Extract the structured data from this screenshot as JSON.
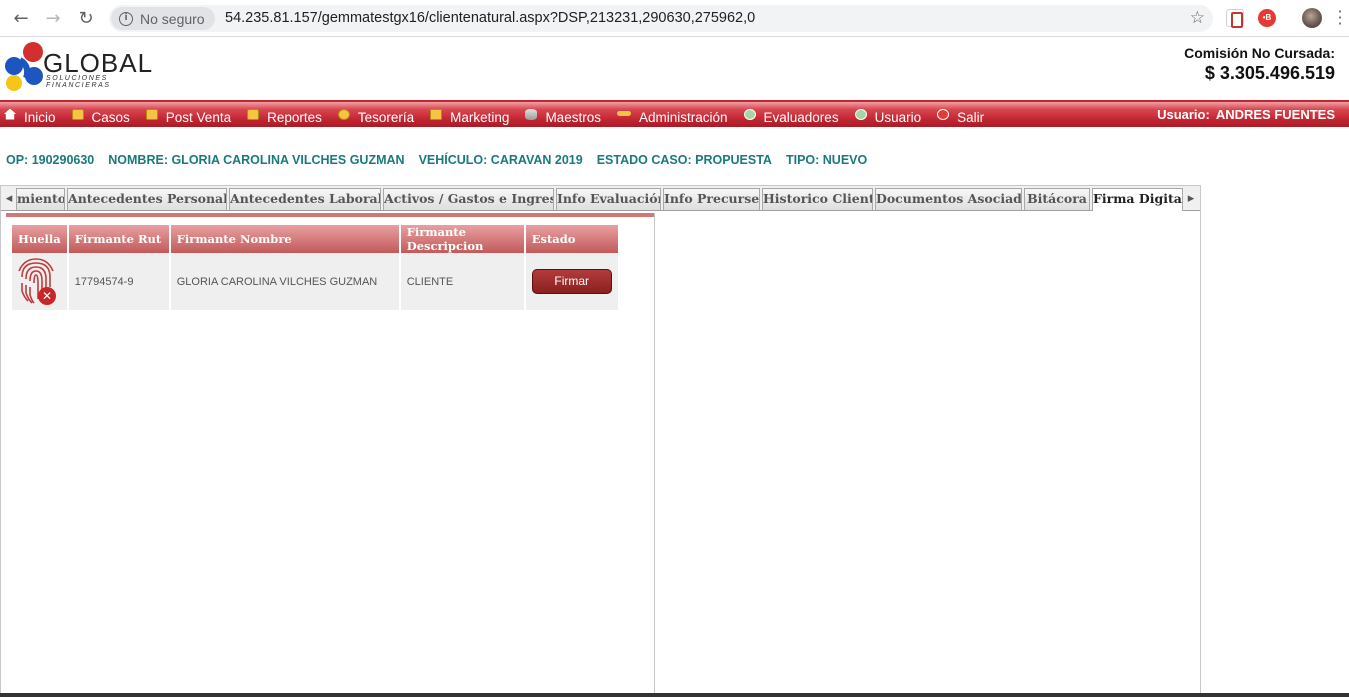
{
  "browser": {
    "security_label": "No seguro",
    "url": "54.235.81.157/gemmatestgx16/clientenatural.aspx?DSP,213231,290630,275962,0"
  },
  "header": {
    "logo_word": "GLOBAL",
    "logo_sub": "SOLUCIONES FINANCIERAS",
    "commission_label": "Comisión No Cursada:",
    "commission_value": "$ 3.305.496.519"
  },
  "menu": {
    "items": [
      {
        "label": "Inicio",
        "icon": "home-icon"
      },
      {
        "label": "Casos",
        "icon": "folder-icon"
      },
      {
        "label": "Post Venta",
        "icon": "folder-icon"
      },
      {
        "label": "Reportes",
        "icon": "folder-icon"
      },
      {
        "label": "Tesorería",
        "icon": "coin-icon"
      },
      {
        "label": "Marketing",
        "icon": "monitor-icon"
      },
      {
        "label": "Maestros",
        "icon": "database-icon"
      },
      {
        "label": "Administración",
        "icon": "key-icon"
      },
      {
        "label": "Evaluadores",
        "icon": "users-icon"
      },
      {
        "label": "Usuario",
        "icon": "users-icon"
      },
      {
        "label": "Salir",
        "icon": "exit-icon"
      }
    ],
    "user_label": "Usuario:",
    "user_name": "ANDRES FUENTES"
  },
  "case_info": {
    "op": "OP: 190290630",
    "nombre": "NOMBRE: GLORIA CAROLINA VILCHES GUZMAN",
    "vehiculo": "VEHÍCULO: CARAVAN 2019",
    "estado": "ESTADO CASO: PROPUESTA",
    "tipo": "TIPO: NUEVO"
  },
  "tabs": [
    {
      "label": "miento"
    },
    {
      "label": "Antecedentes Personales"
    },
    {
      "label": "Antecedentes Laborales"
    },
    {
      "label": "Activos / Gastos e Ingresos"
    },
    {
      "label": "Info Evaluación"
    },
    {
      "label": "Info Precurse"
    },
    {
      "label": "Historico Cliente"
    },
    {
      "label": "Documentos Asociados"
    },
    {
      "label": "Bitácora"
    },
    {
      "label": "Firma Digital",
      "active": true
    }
  ],
  "signers_table": {
    "headers": [
      "Huella",
      "Firmante Rut",
      "Firmante Nombre",
      "Firmante Descripcion",
      "Estado"
    ],
    "rows": [
      {
        "rut": "17794574-9",
        "nombre": "GLORIA CAROLINA VILCHES GUZMAN",
        "descripcion": "CLIENTE",
        "action_label": "Firmar"
      }
    ]
  },
  "colors": {
    "menu_red": "#c22632",
    "case_info_teal": "#1a7a7a",
    "button_red": "#8b2020"
  }
}
